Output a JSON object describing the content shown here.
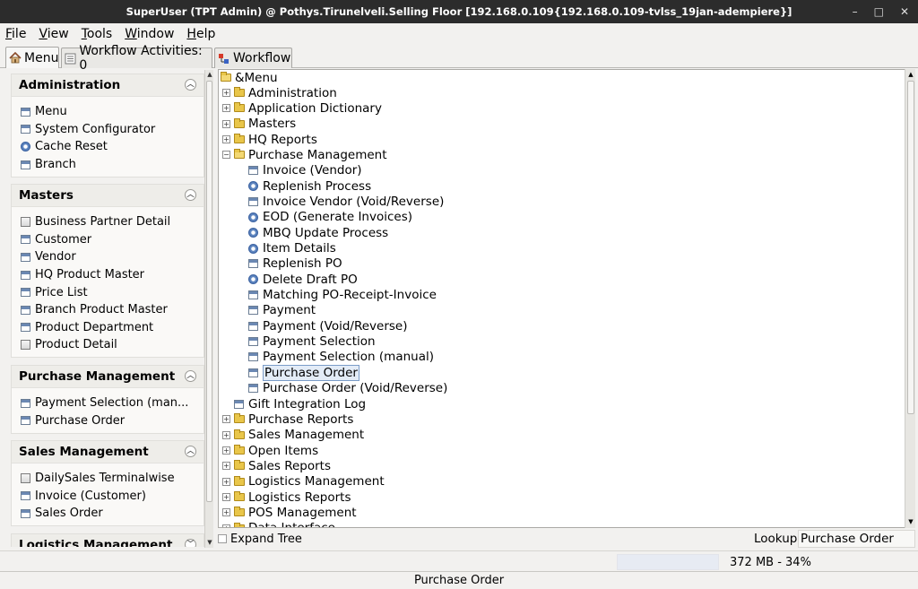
{
  "window": {
    "title": "SuperUser (TPT Admin) @ Pothys.Tirunelveli.Selling Floor [192.168.0.109{192.168.0.109-tvlss_19jan-adempiere}]",
    "min": "–",
    "max": "□",
    "close": "✕"
  },
  "menubar": [
    "File",
    "View",
    "Tools",
    "Window",
    "Help"
  ],
  "tabs": {
    "menu": "Menu",
    "workflow_activities": "Workflow Activities: 0",
    "workflow": "Workflow"
  },
  "sections": [
    {
      "title": "Administration",
      "items": [
        {
          "label": "Menu",
          "icon": "window-icon"
        },
        {
          "label": "System Configurator",
          "icon": "window-icon"
        },
        {
          "label": "Cache Reset",
          "icon": "process-icon"
        },
        {
          "label": "Branch",
          "icon": "window-icon"
        }
      ]
    },
    {
      "title": "Masters",
      "items": [
        {
          "label": "Business Partner Detail",
          "icon": "form-icon"
        },
        {
          "label": "Customer",
          "icon": "window-icon"
        },
        {
          "label": "Vendor",
          "icon": "window-icon"
        },
        {
          "label": "HQ Product Master",
          "icon": "window-icon"
        },
        {
          "label": "Price List",
          "icon": "window-icon"
        },
        {
          "label": "Branch Product Master",
          "icon": "window-icon"
        },
        {
          "label": "Product Department",
          "icon": "window-icon"
        },
        {
          "label": "Product Detail",
          "icon": "form-icon"
        }
      ]
    },
    {
      "title": "Purchase Management",
      "items": [
        {
          "label": "Payment Selection (man...",
          "icon": "window-icon"
        },
        {
          "label": "Purchase Order",
          "icon": "window-icon"
        }
      ]
    },
    {
      "title": "Sales Management",
      "items": [
        {
          "label": "DailySales Terminalwise",
          "icon": "form-icon"
        },
        {
          "label": "Invoice (Customer)",
          "icon": "window-icon"
        },
        {
          "label": "Sales Order",
          "icon": "window-icon"
        }
      ]
    },
    {
      "title": "Logistics Management",
      "items": []
    }
  ],
  "tree": {
    "root": "&Menu",
    "rows": [
      {
        "label": "Administration",
        "kind": "folder",
        "level": 1,
        "expanded": false
      },
      {
        "label": "Application Dictionary",
        "kind": "folder",
        "level": 1,
        "expanded": false
      },
      {
        "label": "Masters",
        "kind": "folder",
        "level": 1,
        "expanded": false
      },
      {
        "label": "HQ Reports",
        "kind": "folder",
        "level": 1,
        "expanded": false
      },
      {
        "label": "Purchase Management",
        "kind": "folder",
        "level": 1,
        "expanded": true
      },
      {
        "label": "Invoice (Vendor)",
        "kind": "window",
        "level": 2
      },
      {
        "label": "Replenish Process",
        "kind": "process",
        "level": 2
      },
      {
        "label": "Invoice Vendor (Void/Reverse)",
        "kind": "window",
        "level": 2
      },
      {
        "label": "EOD (Generate Invoices)",
        "kind": "process",
        "level": 2
      },
      {
        "label": "MBQ Update Process",
        "kind": "process",
        "level": 2
      },
      {
        "label": "Item Details",
        "kind": "process",
        "level": 2
      },
      {
        "label": "Replenish PO",
        "kind": "window",
        "level": 2
      },
      {
        "label": "Delete Draft PO",
        "kind": "process",
        "level": 2
      },
      {
        "label": "Matching PO-Receipt-Invoice",
        "kind": "window",
        "level": 2
      },
      {
        "label": "Payment",
        "kind": "window",
        "level": 2
      },
      {
        "label": "Payment (Void/Reverse)",
        "kind": "window",
        "level": 2
      },
      {
        "label": "Payment Selection",
        "kind": "window",
        "level": 2
      },
      {
        "label": "Payment Selection (manual)",
        "kind": "window",
        "level": 2
      },
      {
        "label": "Purchase Order",
        "kind": "window",
        "level": 2,
        "selected": true
      },
      {
        "label": "Purchase Order (Void/Reverse)",
        "kind": "window",
        "level": 2
      },
      {
        "label": "Gift Integration Log",
        "kind": "window",
        "level": 1,
        "leaf": true
      },
      {
        "label": "Purchase Reports",
        "kind": "folder",
        "level": 1,
        "expanded": false
      },
      {
        "label": "Sales Management",
        "kind": "folder",
        "level": 1,
        "expanded": false
      },
      {
        "label": "Open Items",
        "kind": "folder",
        "level": 1,
        "expanded": false
      },
      {
        "label": "Sales Reports",
        "kind": "folder",
        "level": 1,
        "expanded": false
      },
      {
        "label": "Logistics Management",
        "kind": "folder",
        "level": 1,
        "expanded": false
      },
      {
        "label": "Logistics Reports",
        "kind": "folder",
        "level": 1,
        "expanded": false
      },
      {
        "label": "POS Management",
        "kind": "folder",
        "level": 1,
        "expanded": false
      },
      {
        "label": "Data Interface",
        "kind": "folder",
        "level": 1,
        "expanded": false
      }
    ]
  },
  "bottom": {
    "expand_tree": "Expand Tree",
    "lookup_label": "Lookup",
    "lookup_value": "Purchase Order"
  },
  "memory": {
    "text": "372 MB - 34%",
    "fraction": 0.34
  },
  "status": "Purchase Order",
  "colors": {
    "titlebar": "#2c2c2c",
    "selection": "#e3ecf7",
    "folder": "#e9c64a"
  }
}
